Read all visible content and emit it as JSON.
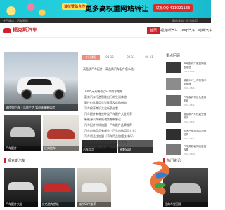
{
  "banner": {
    "pill": "诚征赞助合作",
    "headline": "更多高权重网站转让",
    "contact": "联系QQ:411021133"
  },
  "topbar": {
    "left": "今日焦点 · 汽车资讯",
    "right": "网站导航 · 设为首页"
  },
  "site": {
    "logo_text": "福克斯汽车"
  },
  "nav": {
    "items": [
      "首页",
      "福克斯汽车",
      "Jeep汽车",
      "哈弗汽车"
    ]
  },
  "hero": {
    "caption": "福克斯汽车 · 品质生活 驾驭未来新体验"
  },
  "tabs": {
    "items": [
      "今日播报",
      "08-12",
      "08-11",
      "08-11"
    ]
  },
  "headline": "高品质汽车配件（高品质汽车配件怎么选）",
  "news": [
    "1395元高端省心SUV购车攻略",
    "蔚来汽车打造智能出行新生活体验",
    "高性价比家用车型推荐及选购指南",
    "汽车保养常识大全新手必看",
    "汽车配件有哪些种类汽车配件大全分享",
    "新能源汽车补贴政策最新解读",
    "汽车配件市场加盟 · 汽车配件品牌推荐",
    "汽车内饰用品有哪些（汽车内饰用品大全）",
    "汽车用品店加盟（汽车用品加盟店排行）",
    "二手车交易流程及注意事项全攻略",
    "专业改装店哪家好 · 改装案例分享"
  ],
  "side": {
    "title": "重点回顾",
    "items": [
      {
        "title": "汽车配件厂家直销批发零售",
        "date": "2025-08-12"
      },
      {
        "title": "新款SUV上市热销车型推荐",
        "date": "2025-08-12"
      },
      {
        "title": "汽车保养项目及费用明细",
        "date": "2025-08-11"
      },
      {
        "title": "福克斯汽车性能全面测评",
        "date": "2025-08-11"
      },
      {
        "title": "五大汽车用品店加盟品牌",
        "date": "2025-08-11"
      },
      {
        "title": "汽车美容装饰店经营攻略",
        "date": "2025-08-10"
      }
    ]
  },
  "thumbs": [
    {
      "caption": "汽车配件"
    },
    {
      "caption": "经典跑车"
    },
    {
      "caption": "汽车用品"
    },
    {
      "caption": "越野SUV"
    }
  ],
  "sections": {
    "left": "福克斯汽车",
    "right": "热门资讯"
  },
  "bottom": [
    {
      "caption": "汽车配件大全"
    },
    {
      "caption": "红色跑车赏析"
    },
    {
      "caption": "城市SUV推荐"
    },
    {
      "caption": "经典车型回顾"
    }
  ],
  "colors": {
    "brand": "#d0212a",
    "banner": "#1ec8d8"
  }
}
